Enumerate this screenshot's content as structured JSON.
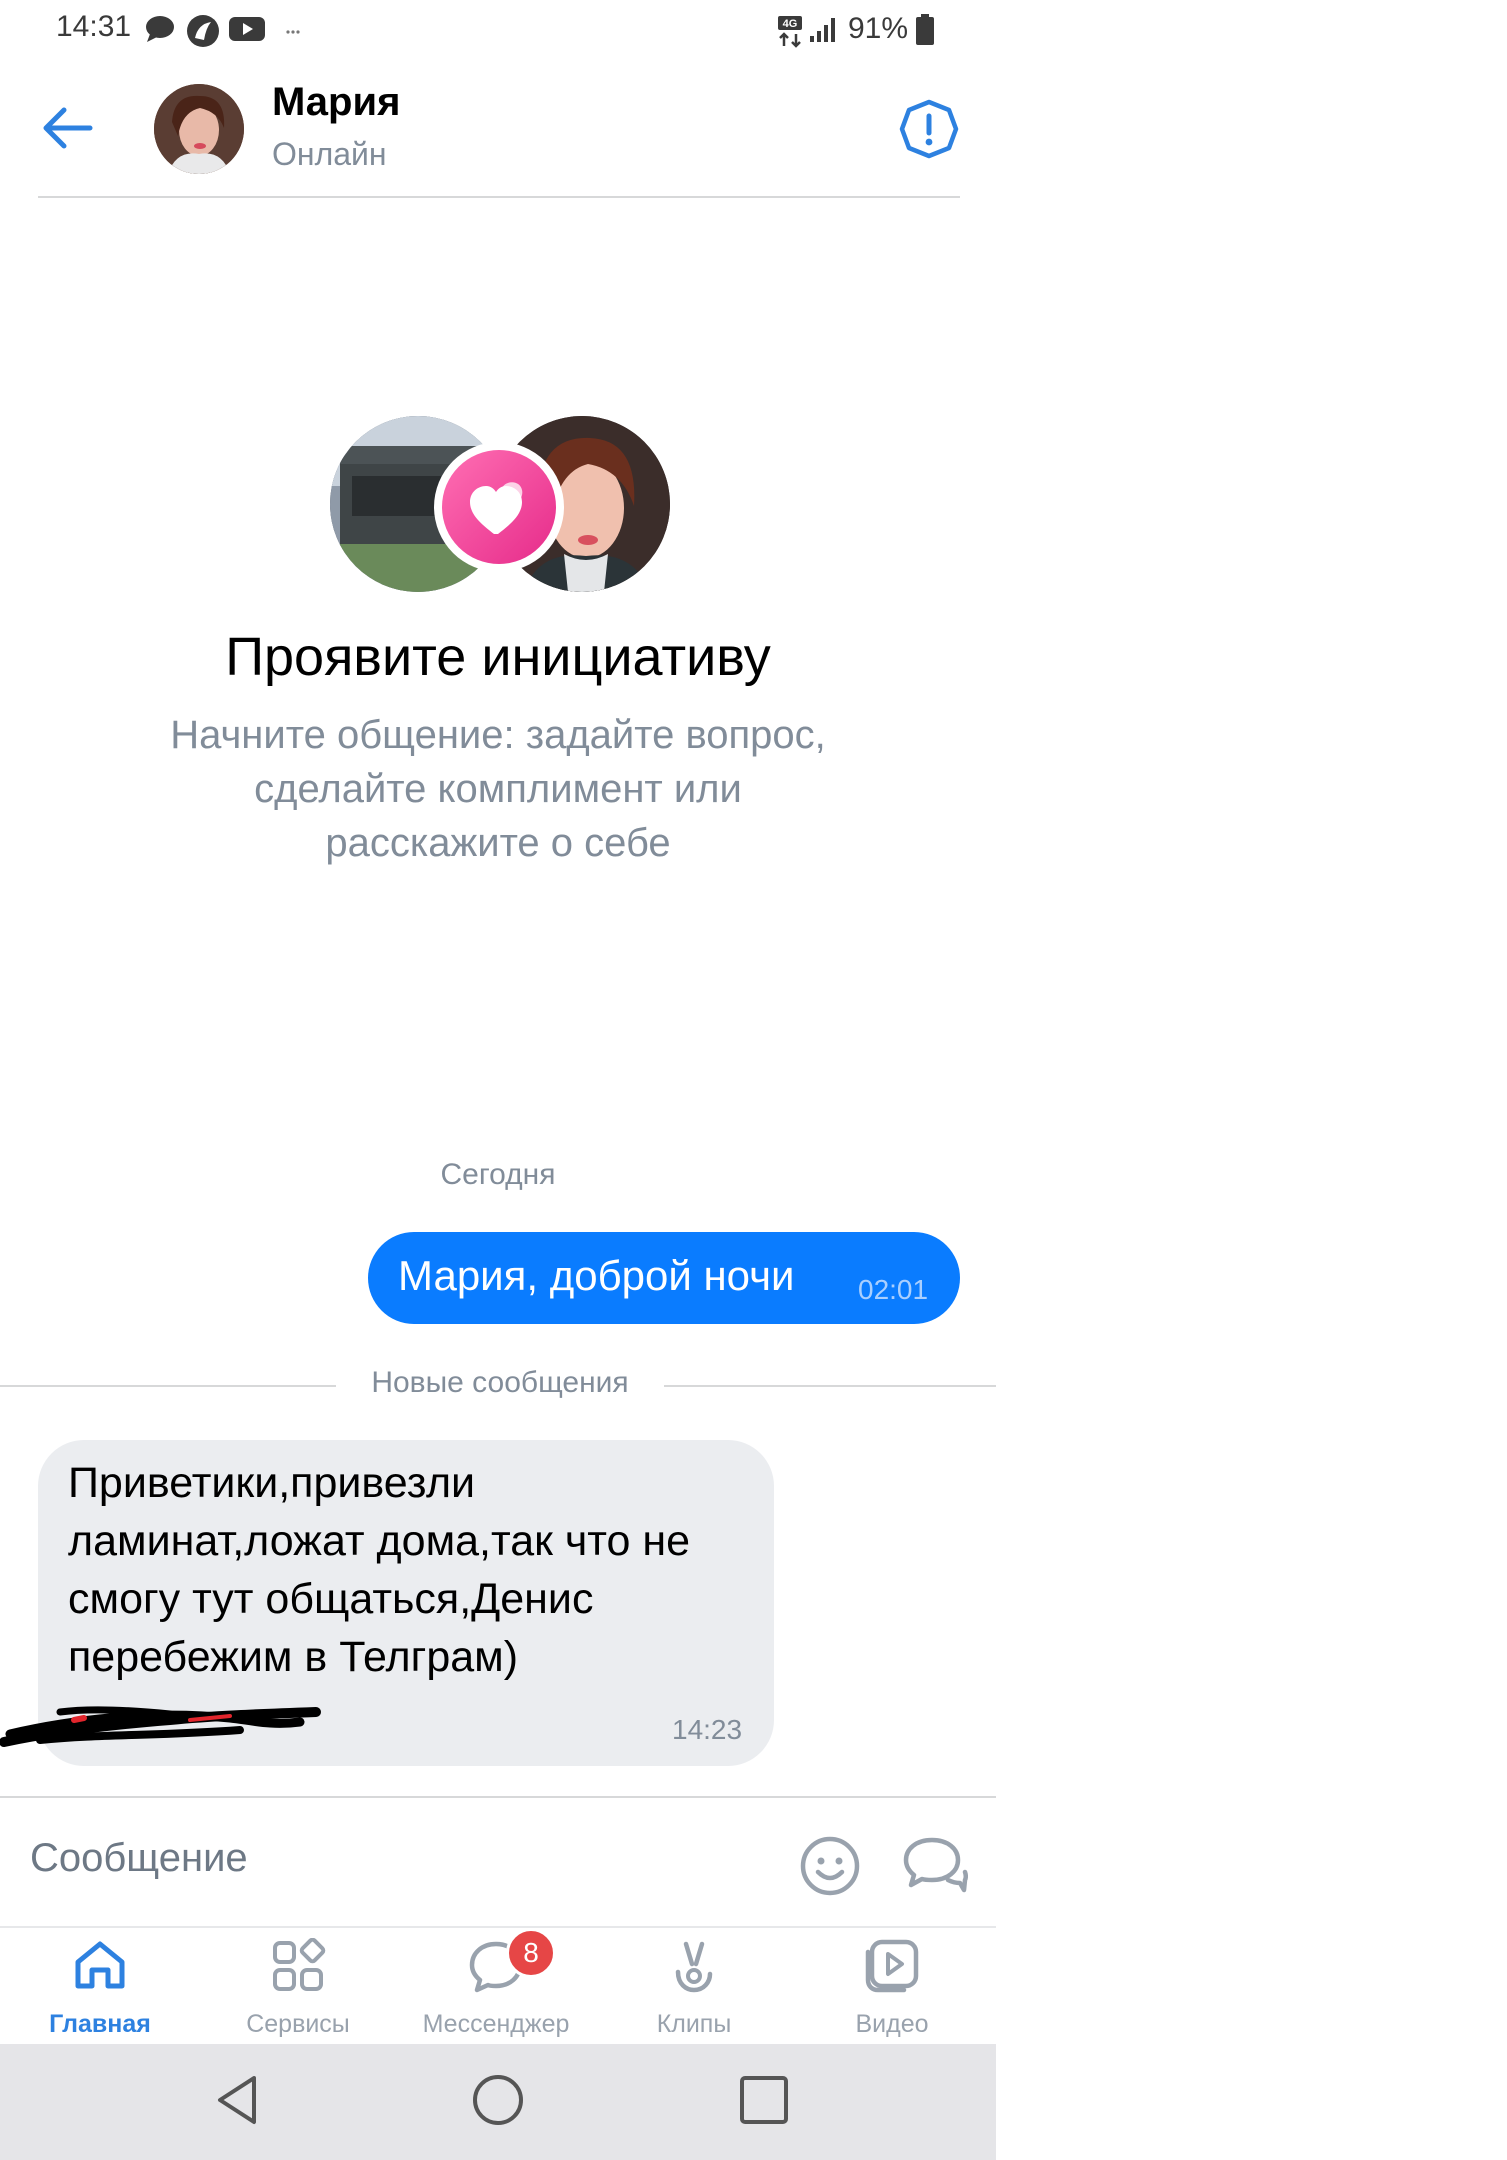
{
  "status_bar": {
    "time": "14:31",
    "network": "4G",
    "battery": "91%"
  },
  "header": {
    "name": "Мария",
    "status": "Онлайн"
  },
  "icebreaker": {
    "title": "Проявите инициативу",
    "text": "Начните общение: задайте вопрос, сделайте комплимент или расскажите о себе"
  },
  "messages": {
    "date_separator": "Сегодня",
    "outgoing": {
      "text": "Мария, доброй ночи",
      "time": "02:01"
    },
    "new_messages_label": "Новые сообщения",
    "incoming": {
      "text": "Приветики,привезли ламинат,ложат дома,так что не смогу тут общаться,Денис перебежим в Телграм)",
      "time": "14:23"
    }
  },
  "composer": {
    "placeholder": "Сообщение"
  },
  "tabbar": {
    "items": [
      {
        "label": "Главная",
        "icon": "home-icon",
        "active": true
      },
      {
        "label": "Сервисы",
        "icon": "services-icon",
        "active": false
      },
      {
        "label": "Мессенджер",
        "icon": "messenger-icon",
        "active": false,
        "badge": "8"
      },
      {
        "label": "Клипы",
        "icon": "clips-icon",
        "active": false
      },
      {
        "label": "Видео",
        "icon": "video-icon",
        "active": false
      }
    ]
  },
  "colors": {
    "accent": "#2d81e0",
    "outgoing_bubble": "#0a7cff",
    "incoming_bubble": "#ebedf0",
    "badge": "#e64646"
  }
}
